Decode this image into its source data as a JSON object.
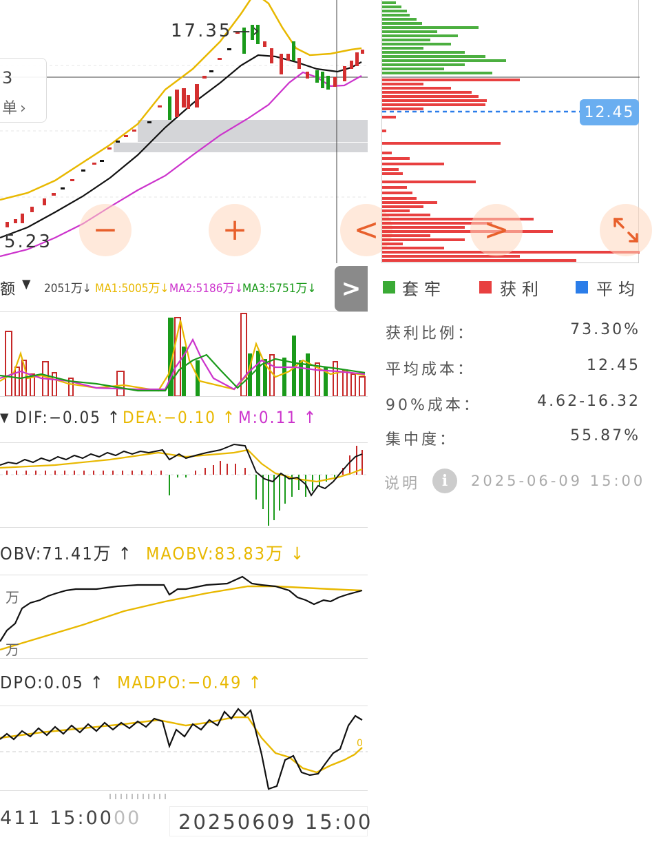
{
  "kline": {
    "high_label": "17.35",
    "low_label": "5.23",
    "popup_partial_value": "3",
    "popup_partial_link": "单"
  },
  "controls": {
    "zoom_out": "−",
    "zoom_in": "+",
    "nav_left": "<",
    "nav_right": ">",
    "expand": "↘↖",
    "panel_toggle": ">"
  },
  "volume_panel": {
    "selector_label": "额",
    "vol": "2051万↓",
    "ma1": "MA1:5005万↓",
    "ma2": "MA2:5186万↓",
    "ma3": "MA3:5751万↓"
  },
  "macd_panel": {
    "dif": "DIF:−0.05 ↑",
    "dea": "DEA:−0.10 ↑",
    "m": "M:0.11 ↑"
  },
  "obv_panel": {
    "obv": "OBV:71.41万 ↑",
    "maobv": "MAOBV:83.83万 ↓",
    "axis_top": "万",
    "axis_bottom": "万"
  },
  "dpo_panel": {
    "dpo": "DPO:0.05 ↑",
    "madpo": "MADPO:−0.49 ↑",
    "zero_label": "0"
  },
  "time_axis": {
    "left": "411 15:00",
    "left_faded": "00",
    "right": "20250609 15:00"
  },
  "chip_distribution": {
    "avg_price_tag": "12.45",
    "legend": [
      {
        "label": "套牢",
        "color": "#3aaa35"
      },
      {
        "label": "获利",
        "color": "#e84040"
      },
      {
        "label": "平均",
        "color": "#2b7de9"
      }
    ],
    "stats": [
      {
        "label": "获利比例：",
        "value": "73.30%"
      },
      {
        "label": "平均成本：",
        "value": "12.45"
      },
      {
        "label": "90%成本：",
        "value": "4.62-16.32"
      },
      {
        "label": "集中度：",
        "value": "55.87%"
      }
    ],
    "note_label": "说明",
    "info_icon": "i",
    "timestamp": "2025-06-09 15:00"
  },
  "colors": {
    "up": "#d32f2f",
    "down": "#1a9a1a",
    "ma_yellow": "#e8b800",
    "ma_magenta": "#cc33cc",
    "ma_black": "#111111",
    "accent_orange": "#e8602c",
    "tag_blue": "#6aaef0"
  }
}
